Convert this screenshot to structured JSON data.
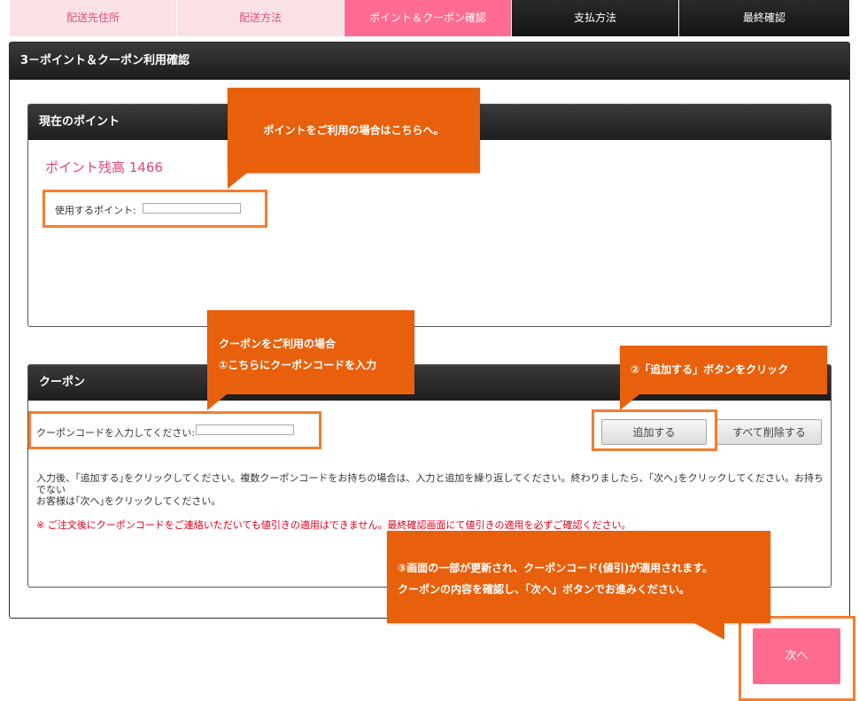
{
  "steps": [
    {
      "label": "配送先住所",
      "state": "done"
    },
    {
      "label": "配送方法",
      "state": "done"
    },
    {
      "label": "ポイント＆クーポン確認",
      "state": "current"
    },
    {
      "label": "支払方法",
      "state": "todo"
    },
    {
      "label": "最終確認",
      "state": "todo"
    }
  ],
  "section_title": "3－ポイント＆クーポン利用確認",
  "points": {
    "header": "現在のポイント",
    "balance_label": "ポイント残高 1466",
    "use_label": "使用するポイント:",
    "use_value": ""
  },
  "coupon": {
    "header": "クーポン",
    "code_label": "クーポンコードを入力してください:",
    "code_value": "",
    "add_button": "追加する",
    "remove_all_button": "すべて削除する",
    "info_line1": "入力後、｢追加する｣をクリックしてください。複数クーポンコードをお持ちの場合は、入力と追加を繰り返してください。終わりましたら、｢次へ｣をクリックしてください。お持ちでない",
    "info_line2": "お客様は｢次へ｣をクリックしてください。",
    "warning": "※ ご注文後にクーポンコードをご連絡いただいても値引きの適用はできません。最終確認画面にて値引きの適用を必ずご確認ください。"
  },
  "next_button": "次へ",
  "callouts": {
    "points": "ポイントをご利用の場合はこちらへ。",
    "coupon_line1": "クーポンをご利用の場合",
    "coupon_line2": "①こちらにクーポンコードを入力",
    "add": "②「追加する」ボタンをクリック",
    "result_line1": "③画面の一部が更新され、クーポンコード(値引)が適用されます。",
    "result_line2": "クーポンの内容を確認し、「次へ」ボタンでお進みください。"
  },
  "colors": {
    "accent_pink": "#ff6b92",
    "callout_orange": "#e8600c",
    "highlight_orange": "#f47d2f",
    "header_dark": "#1c1c1c",
    "warning_red": "#e0001a"
  }
}
